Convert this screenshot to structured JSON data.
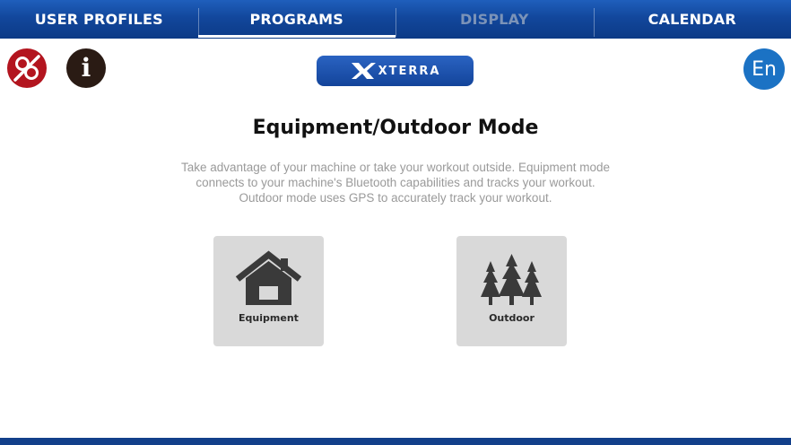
{
  "nav": {
    "tabs": [
      {
        "label": "USER PROFILES"
      },
      {
        "label": "PROGRAMS"
      },
      {
        "label": "DISPLAY"
      },
      {
        "label": "CALENDAR"
      }
    ],
    "active_tab": "PROGRAMS",
    "disabled_tab": "DISPLAY"
  },
  "toolbar": {
    "info_glyph": "i",
    "language_label": "En"
  },
  "brand": {
    "logo_text": "XTERRA",
    "logo_color": "#1a4fae"
  },
  "main": {
    "title": "Equipment/Outdoor Mode",
    "description_lines": [
      "Take advantage of your machine or take your workout outside. Equipment mode",
      "connects to your machine's Bluetooth capabilities and tracks your workout.",
      "Outdoor mode uses GPS to accurately track your workout."
    ],
    "modes": [
      {
        "label": "Equipment",
        "icon": "house-icon"
      },
      {
        "label": "Outdoor",
        "icon": "trees-icon"
      }
    ]
  },
  "colors": {
    "nav_blue": "#12479c",
    "alert_red": "#b3151f",
    "language_blue": "#1b72c4",
    "card_gray": "#d9d9d9"
  }
}
